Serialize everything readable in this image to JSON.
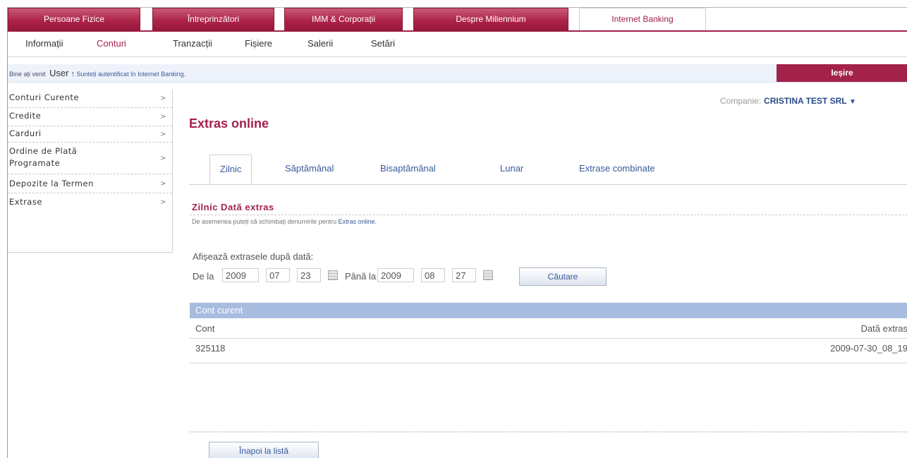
{
  "top_tabs": [
    "Persoane Fizice",
    "Întreprinzători",
    "IMM & Corporații",
    "Despre Millennium",
    "Internet Banking"
  ],
  "active_top_tab": "Internet Banking",
  "sub_nav": [
    "Informații",
    "Conturi",
    "Tranzacții",
    "Fișiere",
    "Salerii",
    "Setări"
  ],
  "active_sub_nav": "Conturi",
  "welcome": {
    "greeting": "Bine ați venit",
    "user": "User",
    "user_icon": "arrow-up-icon",
    "authenticated": "Sunteți autentificat în Internet Banking.",
    "logout": "Ieșire"
  },
  "sidebar": {
    "items": [
      {
        "label": "Conturi Curente"
      },
      {
        "label": "Credite"
      },
      {
        "label": "Carduri"
      },
      {
        "label": "Ordine de Plată Programate"
      },
      {
        "label": "Depozite la Termen"
      },
      {
        "label": "Extrase"
      }
    ],
    "arrow_glyph": ">"
  },
  "company": {
    "label": "Companie:",
    "value": "CRISTINA TEST SRL",
    "icon": "caret-down-icon"
  },
  "page_title": "Extras online",
  "tabs": [
    "Zilnic",
    "Săptămânal",
    "Bisaptămânal",
    "Lunar",
    "Extrase combinate"
  ],
  "active_tab": "Zilnic",
  "section": {
    "title": "Zilnic Dată extras",
    "note": "De asemenea puteți să schimbați denumirile pentru",
    "note_link": "Extras online."
  },
  "filter": {
    "label": "Afișează extrasele după dată:",
    "from_label": "De la",
    "from": {
      "year": "2009",
      "month": "07",
      "day": "23"
    },
    "to_label": "Până la",
    "to": {
      "year": "2009",
      "month": "08",
      "day": "27"
    },
    "calendar_icon": "calendar-icon",
    "search_button": "Căutare"
  },
  "panel": {
    "title": "Cont curent",
    "columns": [
      "Cont",
      "Dată extras"
    ],
    "rows": [
      {
        "account": "325118",
        "date": "2009-07-30_08_19"
      }
    ]
  },
  "back_button": "Înapoi la listă",
  "colors": {
    "brand": "#a3224a",
    "link": "#3a5a9a",
    "panel_header": "#a8bce0"
  }
}
